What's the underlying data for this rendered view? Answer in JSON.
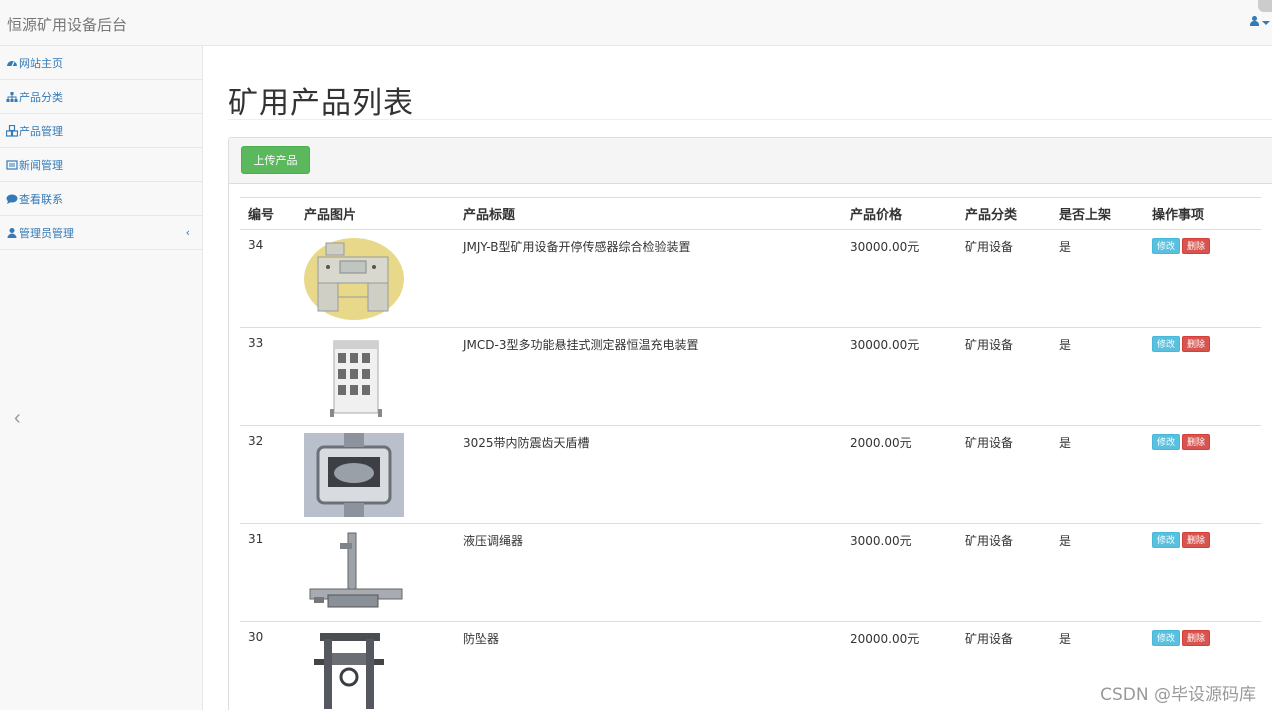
{
  "header": {
    "brand": "恒源矿用设备后台"
  },
  "sidebar": {
    "items": [
      {
        "label": "网站主页",
        "icon": "dashboard-icon"
      },
      {
        "label": "产品分类",
        "icon": "sitemap-icon"
      },
      {
        "label": "产品管理",
        "icon": "cubes-icon"
      },
      {
        "label": "新闻管理",
        "icon": "newspaper-icon"
      },
      {
        "label": "查看联系",
        "icon": "comment-icon"
      },
      {
        "label": "管理员管理",
        "icon": "user-icon"
      }
    ]
  },
  "main": {
    "title": "矿用产品列表",
    "upload_label": "上传产品",
    "columns": [
      "编号",
      "产品图片",
      "产品标题",
      "产品价格",
      "产品分类",
      "是否上架",
      "操作事项"
    ],
    "rows": [
      {
        "id": "34",
        "image": "sensor-test-device-image",
        "title": "JMJY-B型矿用设备开停传感器综合检验装置",
        "price": "30000.00元",
        "category": "矿用设备",
        "listed": "是"
      },
      {
        "id": "33",
        "image": "charging-rack-image",
        "title": "JMCD-3型多功能悬挂式测定器恒温充电装置",
        "price": "30000.00元",
        "category": "矿用设备",
        "listed": "是"
      },
      {
        "id": "32",
        "image": "cable-trough-image",
        "title": "3025带内防震齿天盾槽",
        "price": "2000.00元",
        "category": "矿用设备",
        "listed": "是"
      },
      {
        "id": "31",
        "image": "hydraulic-rope-adjuster-image",
        "title": "液压调绳器",
        "price": "3000.00元",
        "category": "矿用设备",
        "listed": "是"
      },
      {
        "id": "30",
        "image": "fall-arrester-image",
        "title": "防坠器",
        "price": "20000.00元",
        "category": "矿用设备",
        "listed": "是"
      }
    ],
    "edit_label": "修改",
    "delete_label": "删除"
  },
  "watermark": "CSDN @毕设源码库",
  "colors": {
    "link": "#337ab7",
    "success": "#5cb85c",
    "info": "#5bc0de",
    "danger": "#d9534f"
  }
}
